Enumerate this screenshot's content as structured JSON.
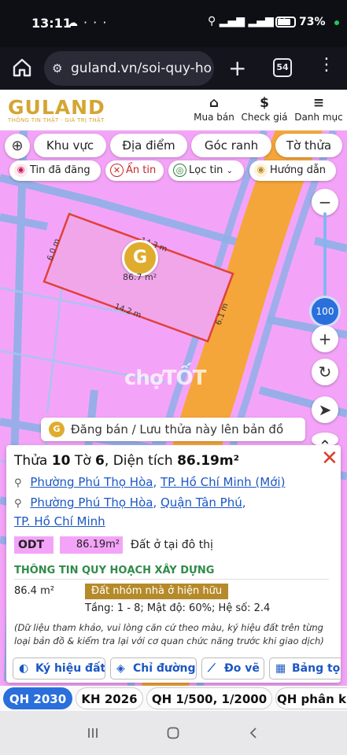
{
  "status": {
    "time": "13:11",
    "battery": "73%"
  },
  "browser": {
    "url": "guland.vn/soi-quy-ho",
    "tab_count": "54"
  },
  "header": {
    "logo": "GULAND",
    "tagline": "THÔNG TIN THẬT - GIÁ TRỊ THẬT",
    "nav": [
      {
        "label": "Mua bán"
      },
      {
        "label": "Check giá"
      },
      {
        "label": "Danh mục"
      }
    ]
  },
  "filters": {
    "tabs": [
      "Khu vực",
      "Địa điểm",
      "Góc ranh",
      "Tờ thửa"
    ],
    "chips": [
      "Tin đã đăng",
      "Ẩn tin",
      "Lọc tin",
      "Hướng dẫn"
    ]
  },
  "map": {
    "zoom_level": "100",
    "parcel_area": "86.7 m²",
    "dims": {
      "top": "14.3 m",
      "left": "6.0 m",
      "bottom": "14.2 m",
      "right": "6.1 m"
    },
    "watermark": "chợTỐT",
    "banner": "Đăng bán / Lưu thửa này lên bản đồ"
  },
  "card": {
    "title_prefix": "Thửa",
    "parcel_no": "10",
    "sheet_label": "Tờ",
    "sheet_no": "6",
    "area_label": "Diện tích",
    "area": "86.19m²",
    "addr1_ward": "Phường Phú Thọ Hòa",
    "addr1_city": "TP. Hồ Chí Minh (Mới)",
    "addr2_ward": "Phường Phú Thọ Hòa",
    "addr2_district": "Quận Tân Phú",
    "addr2_city": "TP. Hồ Chí Minh",
    "land_code": "ODT",
    "land_area": "86.19m²",
    "land_desc": "Đất ở tại đô thị",
    "section_title": "THÔNG TIN QUY HOẠCH XÂY DỰNG",
    "plan_area": "86.4 m²",
    "plan_land": "Đất nhóm nhà ở hiện hữu",
    "plan_meta": "Tầng: 1 - 8; Mật độ: 60%; Hệ số: 2.4",
    "note": "(Dữ liệu tham khảo, vui lòng căn cứ theo màu, ký hiệu đất trên từng loại bản đồ & kiểm tra lại với cơ quan chức năng trước khi giao dịch)",
    "actions": [
      "Ký hiệu đất",
      "Chỉ đường",
      "Đo vẽ",
      "Bảng tọa"
    ]
  },
  "plans": [
    "QH 2030",
    "KH 2026",
    "QH 1/500, 1/2000",
    "QH phân k"
  ],
  "colors": {
    "brand": "#d4a531",
    "residential": "#f4a4f8",
    "road": "#f4a63a",
    "accent": "#2a6fdb"
  }
}
